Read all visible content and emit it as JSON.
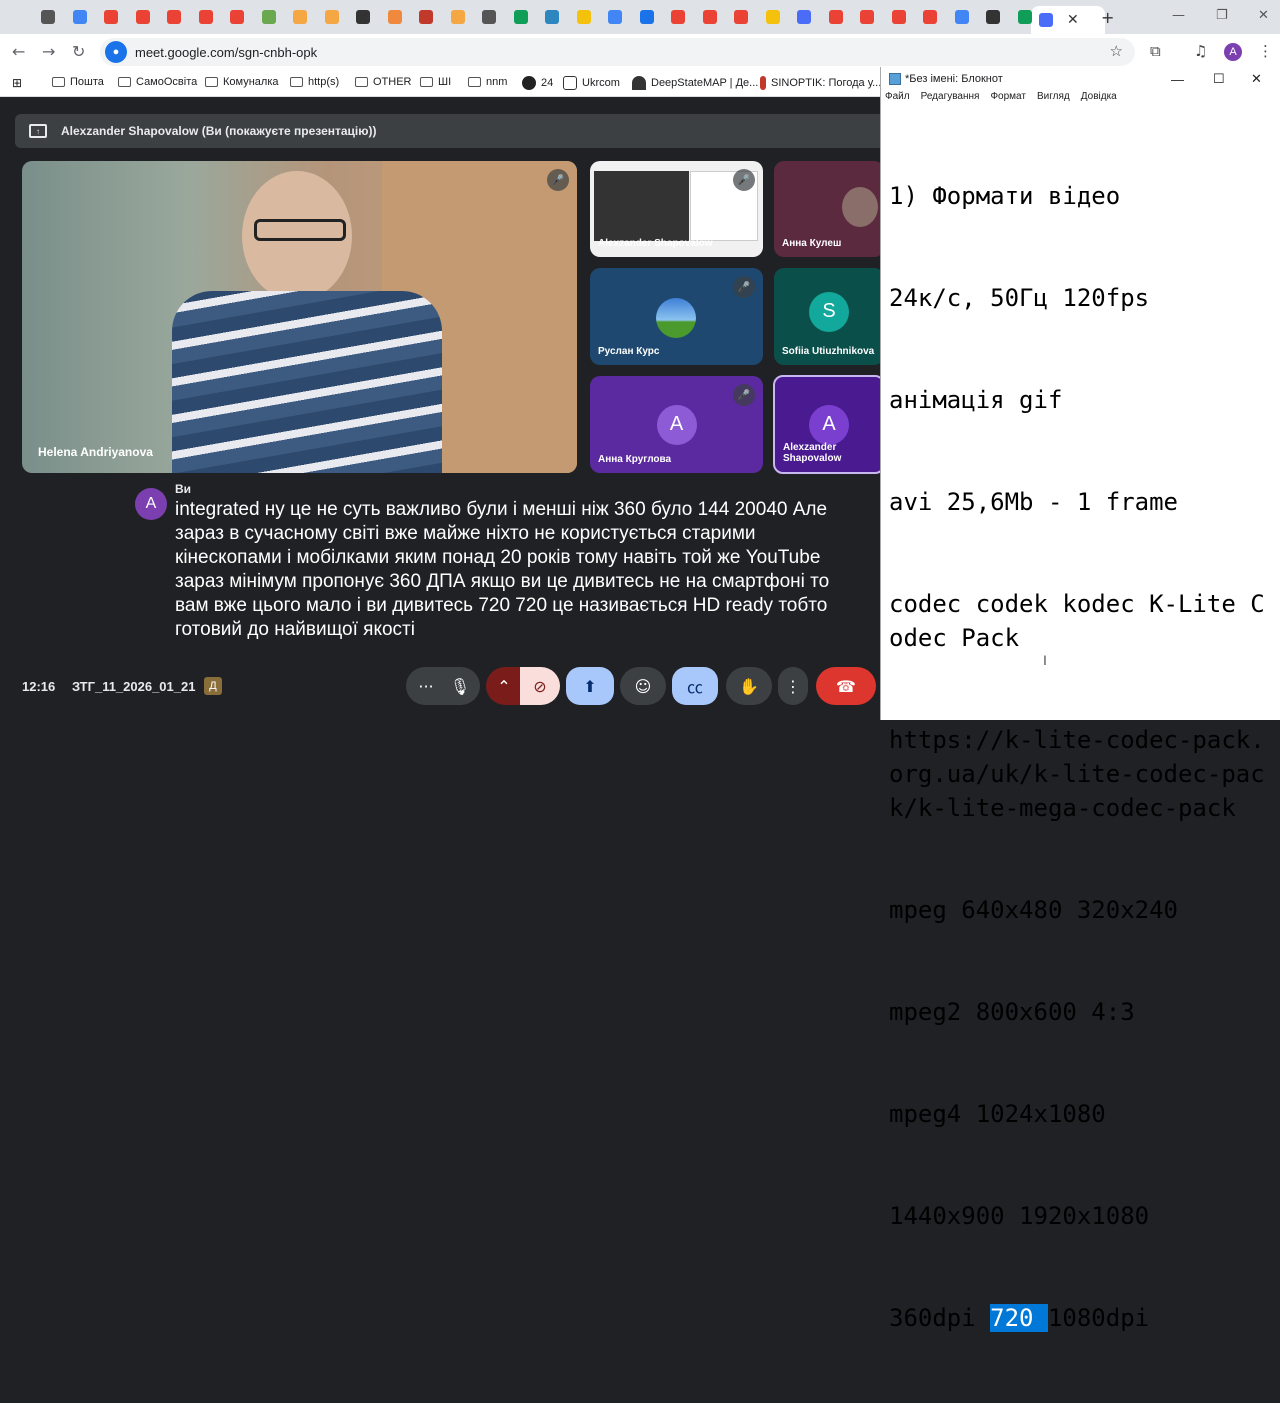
{
  "browser": {
    "url": "meet.google.com/sgn-cnbh-opk",
    "account_initial": "A",
    "tab_close": "✕",
    "new_tab": "+",
    "tab_colors": [
      "#555",
      "#4285f4",
      "#ea4335",
      "#ea4335",
      "#ea4335",
      "#ea4335",
      "#ea4335",
      "#6aa84f",
      "#f4a742",
      "#f4a742",
      "#333",
      "#f0883e",
      "#c0392b",
      "#f4a742",
      "#555",
      "#0f9d58",
      "#2e86c1",
      "#f4c20d",
      "#4285f4",
      "#1a73e8",
      "#ea4335",
      "#ea4335",
      "#ea4335",
      "#f4c20d",
      "#4a6cf7",
      "#ea4335",
      "#ea4335",
      "#ea4335",
      "#ea4335",
      "#4285f4",
      "#333",
      "#0f9d58",
      "#555",
      "#4a6cf7"
    ]
  },
  "bookmarks": [
    {
      "label": "Пошта"
    },
    {
      "label": "СамоОсвіта"
    },
    {
      "label": "Комуналка"
    },
    {
      "label": "http(s)"
    },
    {
      "label": "OTHER"
    },
    {
      "label": "ШІ"
    },
    {
      "label": "nnm"
    },
    {
      "label": "24"
    },
    {
      "label": "Ukrcom"
    },
    {
      "label": "DeepStateMAP | Де..."
    },
    {
      "label": "SINOPTIK: Погода у..."
    }
  ],
  "meet": {
    "presenting_banner": "Alexzander Shapovalow (Ви (покажуєте презентацію))",
    "main_speaker": "Helena Andriyanova",
    "tiles": [
      {
        "name": "Alexzander Shapovalow"
      },
      {
        "name": "Анна Кулеш"
      },
      {
        "name": "Руслан Курс"
      },
      {
        "name": "Sofiia Utiuzhnikova",
        "initial": "S"
      },
      {
        "name": "Анна Круглова",
        "initial": "A"
      },
      {
        "name": "Alexzander Shapovalow",
        "initial": "A"
      }
    ],
    "caption": {
      "speaker_initial": "A",
      "speaker": "Ви",
      "text": "integrated ну це не суть важливо були і менші ніж 360 було 144 20040 Але зараз в сучасному світі вже майже ніхто не користується старими кінескопами і мобілками яким понад 20 років тому навіть той же YouTube зараз мінімум пропонує 360 ДПА якщо ви це дивитесь не на смартфоні то вам вже цього мало і ви дивитесь 720 720 це називається HD ready тобто готовий до найвищої якості"
    },
    "time": "12:16",
    "meeting_name": "ЗТГ_11_2026_01_21",
    "colors": {
      "end_call": "#dc362e",
      "cam_off": "#f9dedc",
      "active_blue": "#a8c7fa"
    }
  },
  "notepad": {
    "title": "*Без імені: Блокнот",
    "menu": [
      "Файл",
      "Редагування",
      "Формат",
      "Вигляд",
      "Довідка"
    ],
    "lines": [
      "1) Формати відео",
      "24к/с, 50Гц 120fps",
      "анімація gif",
      "avi 25,6Mb - 1 frame",
      "codec codek kodec K-Lite Codec Pack",
      "https://k-lite-codec-pack.org.ua/uk/k-lite-codec-pack/k-lite-mega-codec-pack",
      "mpeg 640x480 320x240",
      "mpeg2 800x600 4:3",
      "mpeg4 1024x1080",
      "1440x900 1920x1080"
    ],
    "last_line_before": "360dpi ",
    "selected_text": "720 ",
    "last_line_after": "1080dpi",
    "cursor": "I"
  }
}
